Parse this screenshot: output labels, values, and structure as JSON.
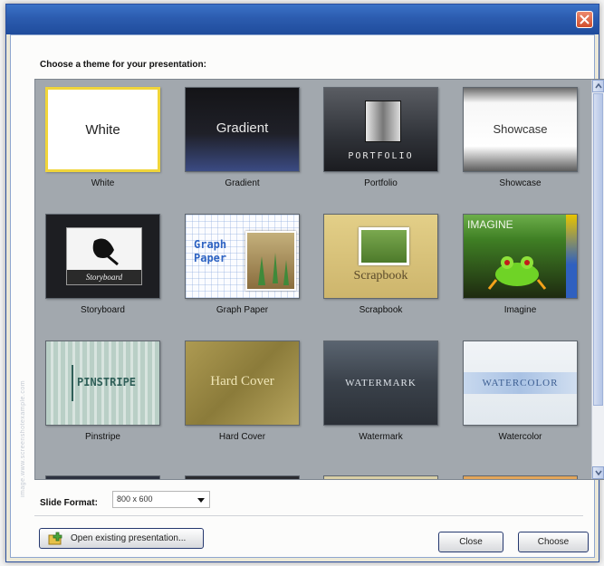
{
  "dialog": {
    "prompt": "Choose a theme for your presentation:",
    "side_watermark": "image.www.screenshotexample.com"
  },
  "themes": [
    {
      "id": "white",
      "preview_text": "White",
      "caption": "White",
      "selected": true
    },
    {
      "id": "gradient",
      "preview_text": "Gradient",
      "caption": "Gradient",
      "selected": false
    },
    {
      "id": "portfolio",
      "preview_text": "PORTFOLIO",
      "caption": "Portfolio",
      "selected": false
    },
    {
      "id": "showcase",
      "preview_text": "Showcase",
      "caption": "Showcase",
      "selected": false
    },
    {
      "id": "storyboard",
      "preview_text": "Storyboard",
      "caption": "Storyboard",
      "selected": false
    },
    {
      "id": "graph-paper",
      "preview_text": "Graph Paper",
      "caption": "Graph Paper",
      "selected": false
    },
    {
      "id": "scrapbook",
      "preview_text": "Scrapbook",
      "caption": "Scrapbook",
      "selected": false
    },
    {
      "id": "imagine",
      "preview_text": "IMAGINE",
      "caption": "Imagine",
      "selected": false
    },
    {
      "id": "pinstripe",
      "preview_text": "PINSTRIPE",
      "caption": "Pinstripe",
      "selected": false
    },
    {
      "id": "hard-cover",
      "preview_text": "Hard Cover",
      "caption": "Hard Cover",
      "selected": false
    },
    {
      "id": "watermark",
      "preview_text": "WATERMARK",
      "caption": "Watermark",
      "selected": false
    },
    {
      "id": "watercolor",
      "preview_text": "WATERCOLOR",
      "caption": "Watercolor",
      "selected": false
    }
  ],
  "slide_format": {
    "label": "Slide Format:",
    "value": "800 x 600"
  },
  "buttons": {
    "open_existing": "Open existing presentation...",
    "close": "Close",
    "choose": "Choose"
  },
  "colors": {
    "title_bar": "#2c5caf",
    "gallery_background": "#a2a8ae",
    "selection_border": "#f0d53a",
    "close_red": "#d04e2c"
  },
  "icons": {
    "title_close": "close-icon",
    "open_existing": "folder-open-icon",
    "dropdown": "chevron-down-icon"
  }
}
